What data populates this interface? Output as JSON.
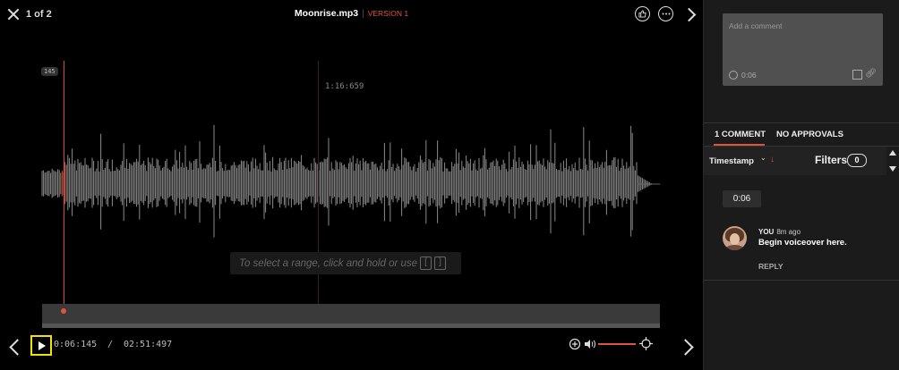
{
  "header": {
    "counter": "1 of 2",
    "title": "Moonrise.mp3",
    "separator": "|",
    "version": "VERSION 1"
  },
  "player": {
    "playhead_marker": "145",
    "hover_time": "1:16:659",
    "hint_text": "To select a range, click and hold or use",
    "hint_keys": [
      "[",
      "]"
    ],
    "current_time": "0:06:145",
    "time_separator": "/",
    "duration": "02:51:497",
    "progress_fraction": 0.036,
    "volume_fraction": 1.0
  },
  "panel": {
    "comment_placeholder": "Add a comment",
    "comment_timestamp": "0:06",
    "tabs": [
      {
        "label": "1 COMMENT"
      },
      {
        "label": "NO APPROVALS"
      }
    ],
    "sort_label": "Timestamp",
    "filters_label": "Filters",
    "filters_count": "0",
    "comments": [
      {
        "timestamp": "0:06",
        "author": "YOU",
        "time_ago": "8m ago",
        "text": "Begin voiceover here.",
        "reply_label": "REPLY"
      }
    ]
  },
  "colors": {
    "accent": "#e0533f",
    "focus_highlight": "#f6e000",
    "background": "#000000",
    "panel": "#1b1b1b"
  },
  "icons": [
    "close-icon",
    "thumbs-up-icon",
    "more-icon",
    "next-chevron-icon",
    "prev-chevron-icon",
    "play-icon",
    "zoom-in-icon",
    "volume-icon",
    "target-icon",
    "clock-icon",
    "checkbox-icon",
    "attach-icon",
    "sort-down-icon",
    "chevron-down-icon"
  ]
}
